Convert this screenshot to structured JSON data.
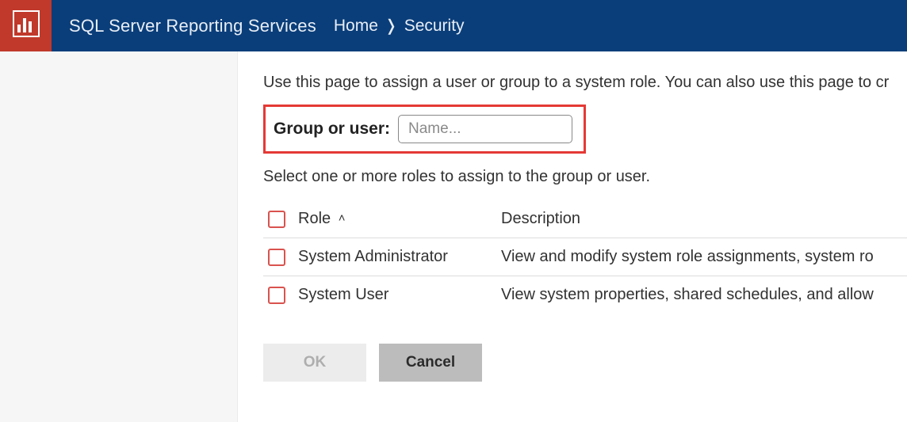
{
  "header": {
    "app_title": "SQL Server Reporting Services",
    "breadcrumb": {
      "home": "Home",
      "current": "Security"
    }
  },
  "main": {
    "intro": "Use this page to assign a user or group to a system role. You can also use this page to cr",
    "group_or_user_label": "Group or user:",
    "name_placeholder": "Name...",
    "select_hint": "Select one or more roles to assign to the group or user.",
    "table": {
      "role_header": "Role",
      "description_header": "Description",
      "rows": [
        {
          "role": "System Administrator",
          "description": "View and modify system role assignments, system ro"
        },
        {
          "role": "System User",
          "description": "View system properties, shared schedules, and allow"
        }
      ]
    },
    "buttons": {
      "ok": "OK",
      "cancel": "Cancel"
    }
  },
  "colors": {
    "header_bg": "#0a3e7a",
    "logo_bg": "#c0392b",
    "highlight_border": "#e53935",
    "checkbox_border": "#d9534f"
  }
}
